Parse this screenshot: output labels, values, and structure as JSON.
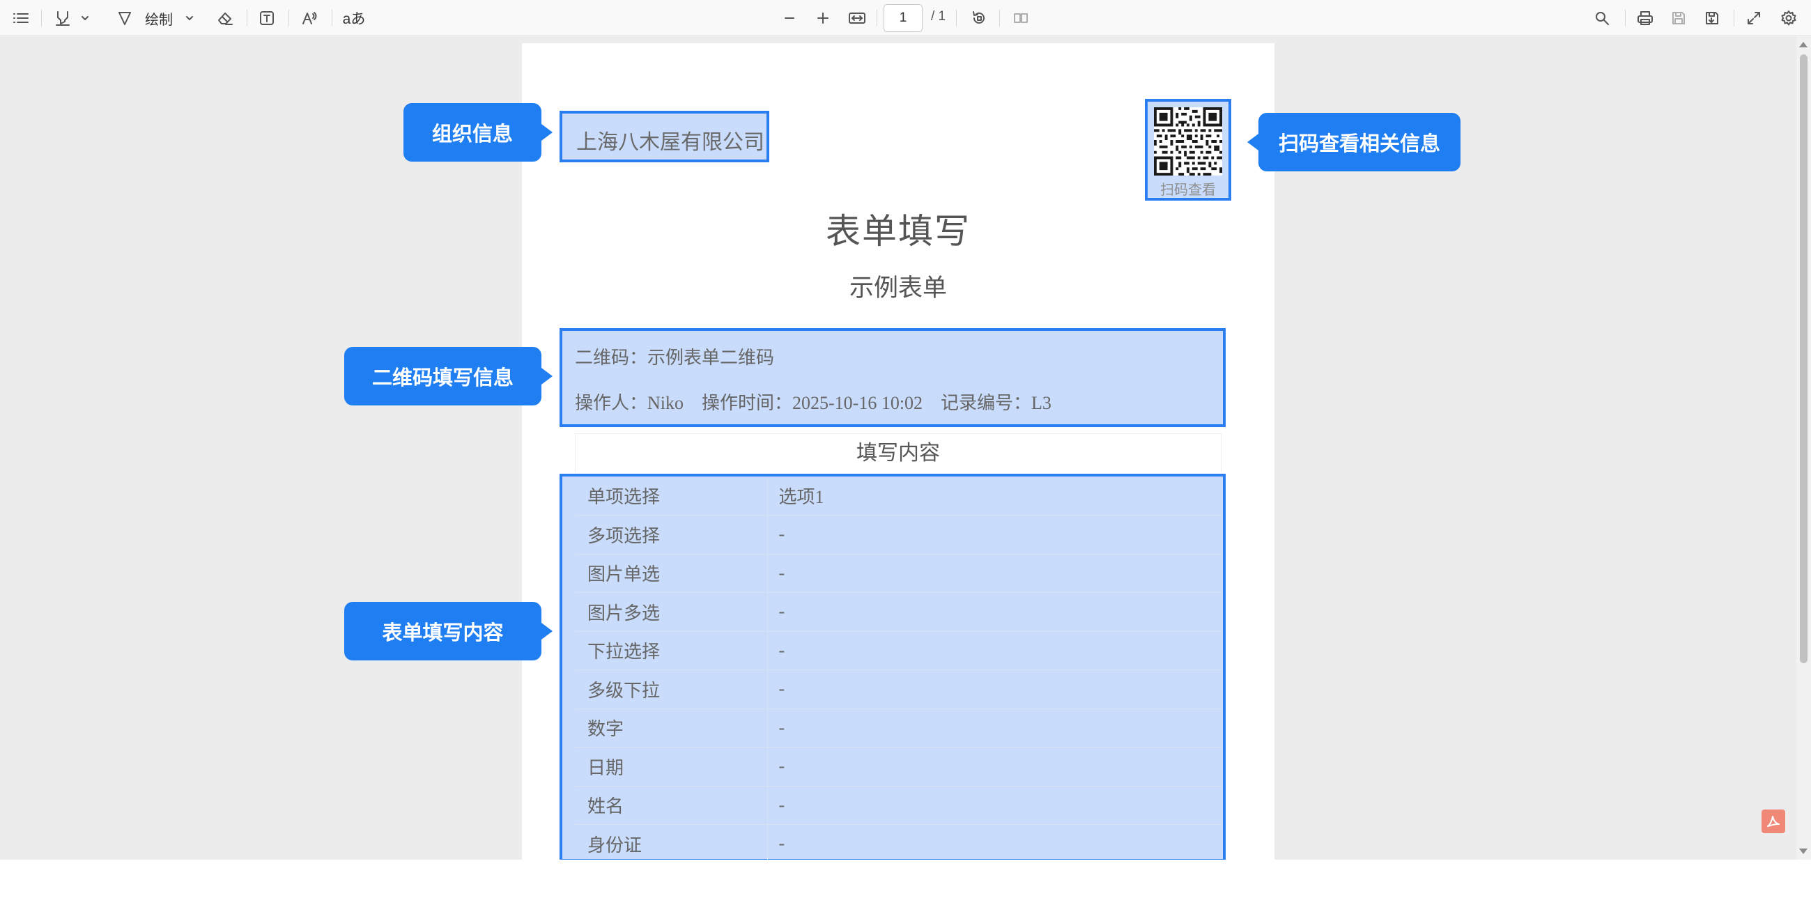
{
  "toolbar": {
    "draw_label": "绘制",
    "translate_label": "aあ",
    "page_current": "1",
    "page_total": "/ 1"
  },
  "document": {
    "org_name": "上海八木屋有限公司",
    "qr_caption": "扫码查看",
    "form_title": "表单填写",
    "form_subtitle": "示例表单",
    "info_line1": "二维码：示例表单二维码",
    "info_line2": "操作人：Niko    操作时间：2025-10-16 10:02    记录编号：L3",
    "section_title": "填写内容",
    "fields": [
      {
        "label": "单项选择",
        "value": "选项1"
      },
      {
        "label": "多项选择",
        "value": "-"
      },
      {
        "label": "图片单选",
        "value": "-"
      },
      {
        "label": "图片多选",
        "value": "-"
      },
      {
        "label": "下拉选择",
        "value": "-"
      },
      {
        "label": "多级下拉",
        "value": "-"
      },
      {
        "label": "数字",
        "value": "-"
      },
      {
        "label": "日期",
        "value": "-"
      },
      {
        "label": "姓名",
        "value": "-"
      },
      {
        "label": "身份证",
        "value": "-"
      }
    ]
  },
  "callouts": {
    "org_info": "组织信息",
    "qr_info": "扫码查看相关信息",
    "qr_fill": "二维码填写信息",
    "form_content": "表单填写内容"
  },
  "colors": {
    "highlight_fill": "#c9dcfb",
    "highlight_border": "#2a7ef0",
    "callout_bg": "#1f7ef1"
  }
}
